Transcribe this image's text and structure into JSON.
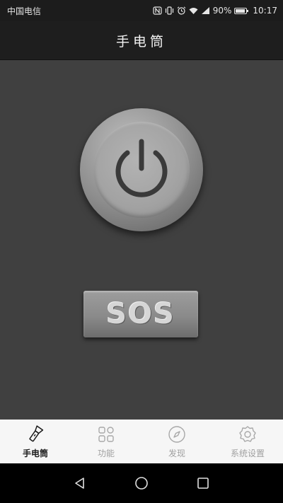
{
  "status_bar": {
    "carrier": "中国电信",
    "battery_percent": "90%",
    "battery_level": 0.9,
    "time": "10:17",
    "icons": [
      "nfc-icon",
      "vibrate-icon",
      "alarm-icon",
      "wifi-icon",
      "signal-icon",
      "battery-icon"
    ]
  },
  "header": {
    "title": "手电筒"
  },
  "main": {
    "power_button_icon": "power-icon",
    "sos_label": "SOS"
  },
  "tabs": [
    {
      "label": "手电筒",
      "icon": "flashlight-icon",
      "active": true
    },
    {
      "label": "功能",
      "icon": "apps-grid-icon",
      "active": false
    },
    {
      "label": "发现",
      "icon": "compass-icon",
      "active": false
    },
    {
      "label": "系统设置",
      "icon": "gear-icon",
      "active": false
    }
  ],
  "nav": {
    "icons": [
      "back-icon",
      "home-icon",
      "recents-icon"
    ]
  },
  "colors": {
    "background": "#404040",
    "title_bar": "#1e1e1e",
    "tab_bar": "#f6f6f6",
    "active_tab": "#1a1a1a",
    "inactive_tab": "#a0a0a0"
  }
}
